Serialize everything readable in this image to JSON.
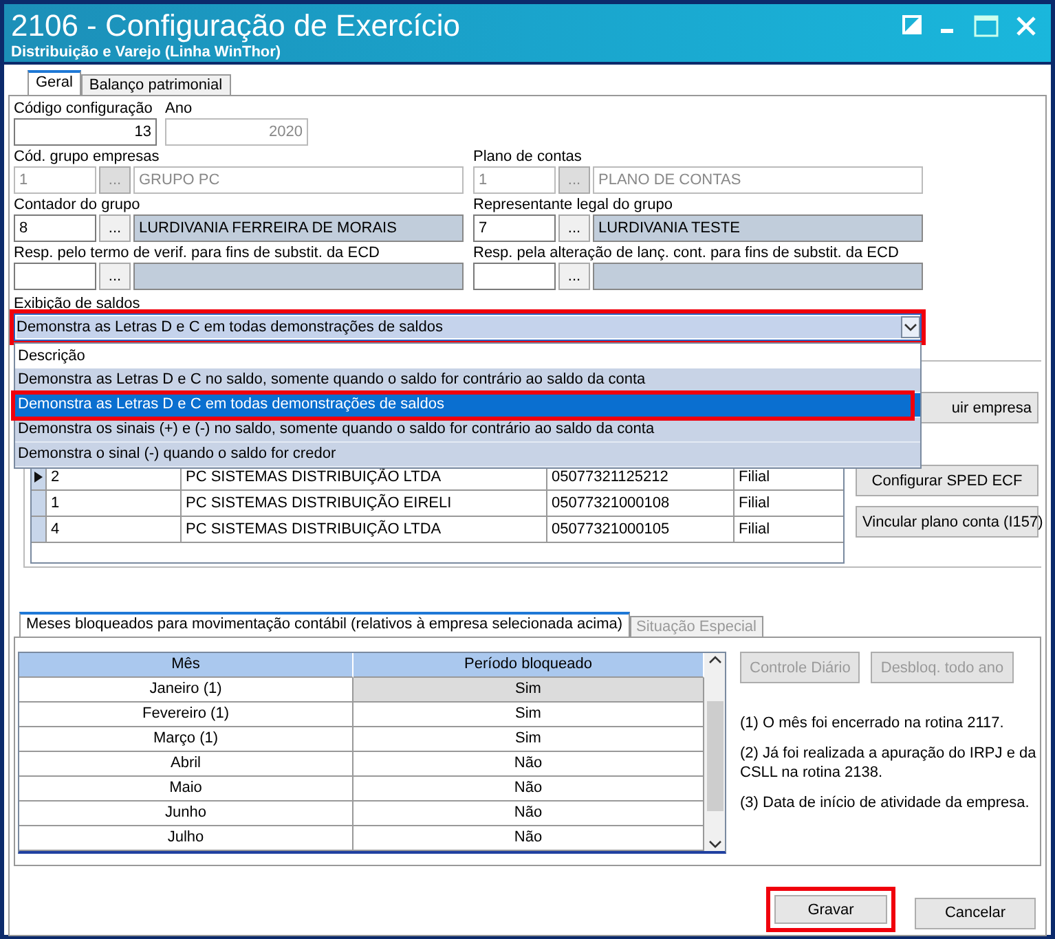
{
  "window": {
    "title": "2106 - Configuração de Exercício",
    "subtitle": "Distribuição e Varejo (Linha WinThor)"
  },
  "tabs": [
    {
      "label": "Geral",
      "selected": true
    },
    {
      "label": "Balanço patrimonial",
      "selected": false
    }
  ],
  "codigo_configuracao": {
    "label": "Código configuração",
    "value": "13"
  },
  "ano": {
    "label": "Ano",
    "value": "2020",
    "disabled": true
  },
  "lookups": [
    {
      "label": "Cód. grupo empresas",
      "code": "1",
      "button": "...",
      "description": "GRUPO PC",
      "disabled": true
    },
    {
      "label": "Plano de contas",
      "code": "1",
      "button": "...",
      "description": "PLANO DE CONTAS",
      "disabled": true
    },
    {
      "label": "Contador do grupo",
      "code": "8",
      "button": "...",
      "description": "LURDIVANIA FERREIRA DE MORAIS",
      "disabled": false
    },
    {
      "label": "Representante legal do grupo",
      "code": "7",
      "button": "...",
      "description": "LURDIVANIA TESTE",
      "disabled": false
    },
    {
      "label": "Resp. pelo termo de verif. para fins de substit. da ECD",
      "button": "...",
      "disabled": false
    },
    {
      "label": "Resp. pela alteração de lanç. cont. para fins de substit. da ECD",
      "button": "...",
      "disabled": false
    }
  ],
  "saldos": {
    "label": "Exibição de saldos",
    "value": "Demonstra as Letras D e C em todas demonstrações de saldos",
    "expanded": true,
    "highlighted": true,
    "list_header": "Descrição",
    "options": [
      {
        "label": "Demonstra as Letras D e C no saldo, somente quando o saldo for contrário ao saldo da conta",
        "selected": false,
        "highlighted": false
      },
      {
        "label": "Demonstra as Letras D e C em todas demonstrações de saldos",
        "selected": true,
        "highlighted": true
      },
      {
        "label": "Demonstra os sinais (+) e (-) no saldo, somente quando o saldo for contrário ao saldo da conta",
        "selected": false,
        "highlighted": false
      },
      {
        "label": "Demonstra o sinal (-) quando o saldo for credor",
        "selected": false,
        "highlighted": false
      }
    ]
  },
  "companies": {
    "rows": [
      {
        "current": true,
        "code": "2",
        "name": "PC SISTEMAS DISTRIBUIÇÃO LTDA",
        "cnpj": "05077321125212",
        "type": "Filial"
      },
      {
        "current": false,
        "code": "1",
        "name": "PC SISTEMAS DISTRIBUIÇÃO  EIRELI",
        "cnpj": "05077321000108",
        "type": "Filial"
      },
      {
        "current": false,
        "code": "4",
        "name": "PC SISTEMAS DISTRIBUIÇÃO LTDA",
        "cnpj": "05077321000105",
        "type": "Filial"
      }
    ],
    "buttons": [
      "uir empresa",
      "Configurar SPED ECF",
      "Vincular plano conta (I157)"
    ]
  },
  "lower_tabs": [
    {
      "label": "Meses bloqueados para movimentação contábil (relativos à empresa selecionada acima)",
      "selected": true
    },
    {
      "label": "Situação Especial",
      "selected": false
    }
  ],
  "months": {
    "columns": [
      "Mês",
      "Período bloqueado"
    ],
    "rows": [
      {
        "month": "Janeiro (1)",
        "blocked": "Sim",
        "selected": true
      },
      {
        "month": "Fevereiro (1)",
        "blocked": "Sim",
        "selected": false
      },
      {
        "month": "Março (1)",
        "blocked": "Sim",
        "selected": false
      },
      {
        "month": "Abril",
        "blocked": "Não",
        "selected": false
      },
      {
        "month": "Maio",
        "blocked": "Não",
        "selected": false
      },
      {
        "month": "Junho",
        "blocked": "Não",
        "selected": false
      },
      {
        "month": "Julho",
        "blocked": "Não",
        "selected": false
      }
    ]
  },
  "month_buttons": [
    {
      "label": "Controle Diário",
      "disabled": true
    },
    {
      "label": "Desbloq. todo ano",
      "disabled": true
    }
  ],
  "notes": [
    "(1)  O mês foi encerrado na rotina 2117.",
    "(2)  Já foi realizada a apuração do IRPJ e da CSLL na rotina 2138.",
    "(3)  Data de início de atividade da empresa."
  ],
  "buttons": [
    {
      "label": "Gravar",
      "highlighted": true
    },
    {
      "label": "Cancelar",
      "highlighted": false
    }
  ]
}
